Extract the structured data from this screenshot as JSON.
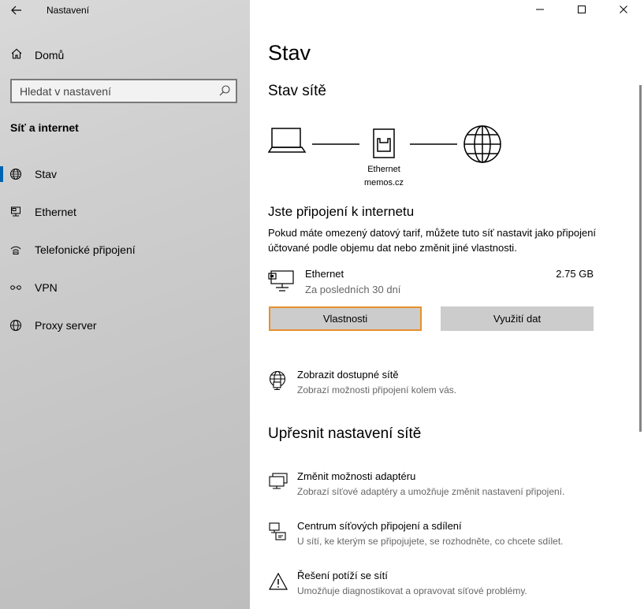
{
  "app": {
    "title": "Nastavení"
  },
  "sidebar": {
    "home_label": "Domů",
    "search_placeholder": "Hledat v nastavení",
    "section_title": "Síť a internet",
    "items": [
      {
        "label": "Stav",
        "icon": "globe-icon",
        "active": true
      },
      {
        "label": "Ethernet",
        "icon": "ethernet-icon",
        "active": false
      },
      {
        "label": "Telefonické připojení",
        "icon": "dialup-icon",
        "active": false
      },
      {
        "label": "VPN",
        "icon": "vpn-icon",
        "active": false
      },
      {
        "label": "Proxy server",
        "icon": "globe-icon",
        "active": false
      }
    ]
  },
  "window": {
    "minimize": "—",
    "maximize": "☐",
    "close": "✕"
  },
  "main": {
    "title": "Stav",
    "network_status_title": "Stav sítě",
    "diagram": {
      "adapter_name": "Ethernet",
      "network_name": "memos.cz"
    },
    "connected_title": "Jste připojení k internetu",
    "connected_desc": "Pokud máte omezený datový tarif, můžete tuto síť nastavit jako připojení účtované podle objemu dat nebo změnit jiné vlastnosti.",
    "ethernet": {
      "name": "Ethernet",
      "period": "Za posledních 30 dní",
      "usage": "2.75 GB"
    },
    "buttons": {
      "properties": "Vlastnosti",
      "data_usage": "Využití dat"
    },
    "show_networks": {
      "title": "Zobrazit dostupné sítě",
      "desc": "Zobrazí možnosti připojení kolem vás."
    },
    "advanced_title": "Upřesnit nastavení sítě",
    "advanced": [
      {
        "title": "Změnit možnosti adaptéru",
        "desc": "Zobrazí síťové adaptéry a umožňuje změnit nastavení připojení.",
        "icon": "adapter-icon"
      },
      {
        "title": "Centrum síťových připojení a sdílení",
        "desc": "U sítí, ke kterým se připojujete, se rozhodněte, co chcete sdílet.",
        "icon": "sharing-center-icon"
      },
      {
        "title": "Řešení potíží se sítí",
        "desc": "Umožňuje diagnostikovat a opravovat síťové problémy.",
        "icon": "warning-icon"
      }
    ]
  }
}
